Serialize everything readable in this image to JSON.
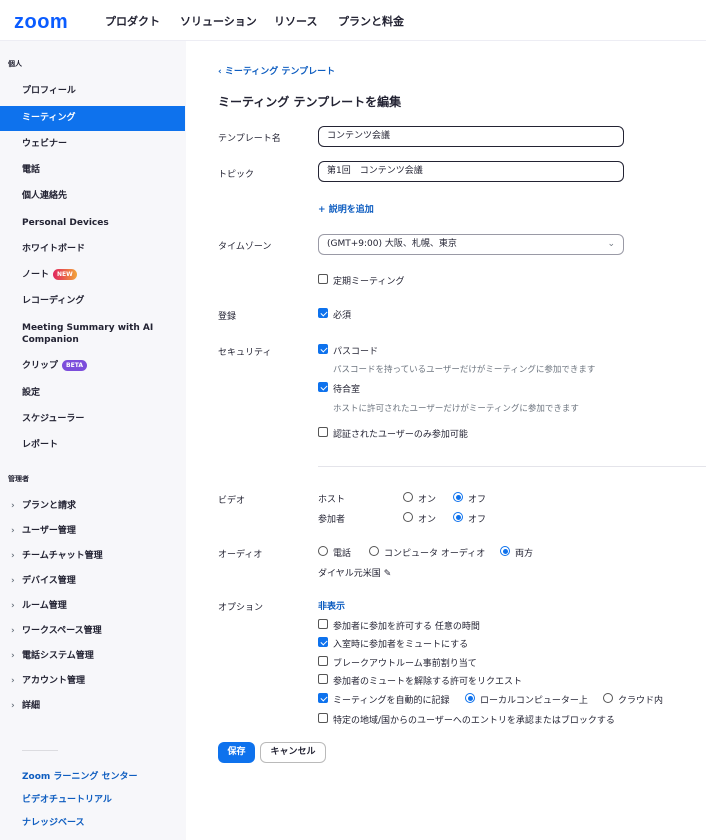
{
  "nav": {
    "logo": "zoom",
    "links": [
      "プロダクト",
      "ソリューション",
      "リソース",
      "プランと料金"
    ]
  },
  "sidebar": {
    "personal_header": "個人",
    "personal_items": [
      {
        "label": "プロフィール"
      },
      {
        "label": "ミーティング",
        "active": true
      },
      {
        "label": "ウェビナー"
      },
      {
        "label": "電話"
      },
      {
        "label": "個人連絡先"
      },
      {
        "label": "Personal Devices"
      },
      {
        "label": "ホワイトボード"
      },
      {
        "label": "ノート",
        "badge": "NEW"
      },
      {
        "label": "レコーディング"
      },
      {
        "label": "Meeting Summary with AI Companion"
      },
      {
        "label": "クリップ",
        "badge": "BETA"
      },
      {
        "label": "設定"
      },
      {
        "label": "スケジューラー"
      },
      {
        "label": "レポート"
      }
    ],
    "admin_header": "管理者",
    "admin_items": [
      "プランと請求",
      "ユーザー管理",
      "チームチャット管理",
      "デバイス管理",
      "ルーム管理",
      "ワークスペース管理",
      "電話システム管理",
      "アカウント管理",
      "詳細"
    ],
    "footer_links": [
      "Zoom ラーニング センター",
      "ビデオチュートリアル",
      "ナレッジベース"
    ]
  },
  "main": {
    "back_link": "ミーティング テンプレート",
    "title": "ミーティング テンプレートを編集",
    "template_name_label": "テンプレート名",
    "template_name_value": "コンテンツ会議",
    "topic_label": "トピック",
    "topic_value": "第1回　コンテンツ会議",
    "add_description": "説明を追加",
    "timezone_label": "タイムゾーン",
    "timezone_value": "(GMT+9:00) 大阪、札幌、東京",
    "recurring_label": "定期ミーティング",
    "recurring_checked": false,
    "registration_label": "登録",
    "registration_option": "必須",
    "registration_checked": true,
    "security_label": "セキュリティ",
    "passcode_label": "パスコード",
    "passcode_checked": true,
    "passcode_hint": "パスコードを持っているユーザーだけがミーティングに参加できます",
    "waiting_room_label": "待合室",
    "waiting_room_checked": true,
    "waiting_room_hint": "ホストに許可されたユーザーだけがミーティングに参加できます",
    "auth_label": "認証されたユーザーのみ参加可能",
    "auth_checked": false,
    "video_label": "ビデオ",
    "host_label": "ホスト",
    "participant_label": "参加者",
    "on_label": "オン",
    "off_label": "オフ",
    "host_video": "off",
    "participant_video": "off",
    "audio_label": "オーディオ",
    "audio_options": [
      "電話",
      "コンピュータ オーディオ",
      "両方"
    ],
    "audio_selected": "両方",
    "dial_in": "ダイヤル元米国",
    "options_label": "オプション",
    "hide_link": "非表示",
    "options": [
      {
        "label": "参加者に参加を許可する 任意の時間",
        "checked": false
      },
      {
        "label": "入室時に参加者をミュートにする",
        "checked": true
      },
      {
        "label": "ブレークアウトルーム事前割り当て",
        "checked": false
      },
      {
        "label": "参加者のミュートを解除する許可をリクエスト",
        "checked": false
      },
      {
        "label": "ミーティングを自動的に記録",
        "checked": true
      },
      {
        "label": "特定の地域/国からのユーザーへのエントリを承認またはブロックする",
        "checked": false
      }
    ],
    "record_local": "ローカルコンピューター上",
    "record_cloud": "クラウド内",
    "record_selected": "local",
    "save_button": "保存",
    "cancel_button": "キャンセル"
  },
  "colors": {
    "brand": "#0b5cff",
    "accent": "#0e72ed",
    "link": "#0e5dc0",
    "sidebar_bg": "#f7f7fa"
  }
}
